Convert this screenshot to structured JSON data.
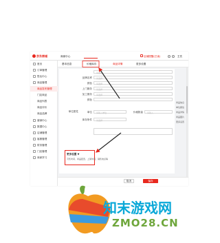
{
  "app": {
    "brand": "京东商城",
    "center": "商家中心",
    "alert": "店铺提醒(已读)",
    "user": "王先"
  },
  "nav": [
    {
      "label": "首页",
      "active": false,
      "sub": false
    },
    {
      "label": "订单管理",
      "active": false,
      "sub": false
    },
    {
      "label": "售后中心",
      "active": false,
      "sub": false
    },
    {
      "label": "商品管理",
      "active": false,
      "sub": false
    },
    {
      "label": "商品发布管理",
      "active": true,
      "sub": true
    },
    {
      "label": "门店商品",
      "active": false,
      "sub": true
    },
    {
      "label": "商品列表",
      "active": false,
      "sub": true
    },
    {
      "label": "商品评价",
      "active": false,
      "sub": true
    },
    {
      "label": "商品品牌",
      "active": false,
      "sub": true
    },
    {
      "label": "营销中心",
      "active": false,
      "sub": false
    },
    {
      "label": "数据中心",
      "active": false,
      "sub": false
    },
    {
      "label": "店铺管理",
      "active": false,
      "sub": false
    },
    {
      "label": "客服管理",
      "active": false,
      "sub": false
    },
    {
      "label": "财务管理",
      "active": false,
      "sub": false
    },
    {
      "label": "门店管理",
      "active": false,
      "sub": false
    },
    {
      "label": "商家学习",
      "active": false,
      "sub": false
    }
  ],
  "tabs": [
    "基本信息",
    "价格库存",
    "商品详情",
    "更多设置"
  ],
  "form": {
    "rows": [
      {
        "label": "",
        "ph": "请选择"
      },
      {
        "label": "品牌名称",
        "ph": "请选择"
      },
      {
        "label": "颜色",
        "ph": "请选择"
      },
      {
        "label": "上门服务",
        "ph": "请选择"
      },
      {
        "label": "加工服务",
        "ph": "请选择"
      },
      {
        "label": "颜色",
        "ph": ""
      }
    ],
    "group_label": "单位属性",
    "row2_label": "单位",
    "row2_ph": "请输入单位",
    "row2_right_label": "价格数量",
    "row2_right_ph": "请输入",
    "row3_label": "库存条件",
    "row3_ph": "请选择"
  },
  "right_links": [
    "商品信息",
    "单位属性",
    "商品详情",
    "商品图片",
    "更多设置"
  ],
  "more": {
    "title": "更多设置",
    "arrow": "▼",
    "desc": "可售时间、商品配置、上架时间、销售地点等"
  },
  "footer": {
    "cancel": "取消",
    "save": "保存"
  },
  "watermark": {
    "title": "知末游戏网",
    "url": "ZMO28.CN"
  }
}
